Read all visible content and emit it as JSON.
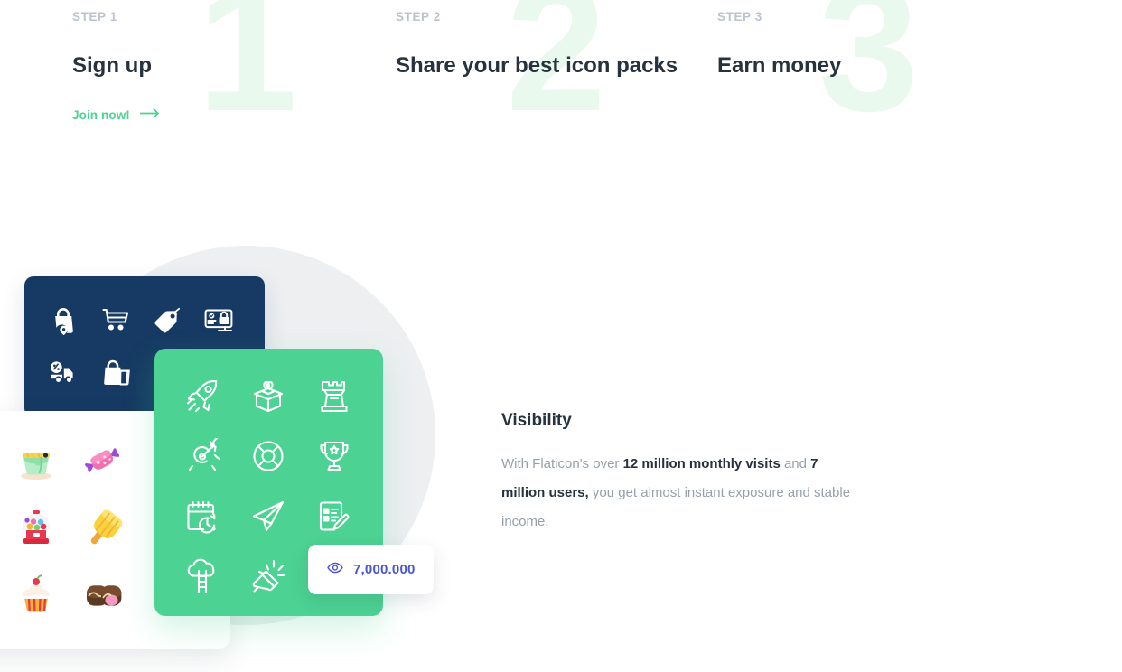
{
  "steps": [
    {
      "label": "STEP 1",
      "watermark": "1",
      "title": "Sign up",
      "cta": {
        "text": "Join now!",
        "icon": "arrow-right-icon"
      }
    },
    {
      "label": "STEP 2",
      "watermark": "2",
      "title": "Share your best icon packs"
    },
    {
      "label": "STEP 3",
      "watermark": "3",
      "title": "Earn money"
    }
  ],
  "illustration": {
    "navy_card": {
      "background": "#163a63",
      "icons": [
        "shopping-bag-location-icon",
        "shopping-cart-icon",
        "price-tag-icon",
        "online-shop-monitor-icon",
        "delivery-truck-discount-icon",
        "shopping-bags-icon"
      ]
    },
    "white_card": {
      "background": "#ffffff",
      "icons": [
        "pudding-icon",
        "wrapped-candy-icon",
        "gumball-machine-icon",
        "popsicle-icon",
        "cupcake-icon",
        "chocolate-bonbon-icon"
      ]
    },
    "green_card": {
      "background": "#4cd292",
      "icons": [
        "rocket-icon",
        "open-box-icon",
        "chess-rook-icon",
        "target-dart-icon",
        "lifebuoy-icon",
        "trophy-icon",
        "calendar-clock-icon",
        "paper-plane-icon",
        "checklist-edit-icon",
        "tree-ladder-icon",
        "megaphone-icon"
      ]
    },
    "views_badge": {
      "icon": "eye-icon",
      "value": "7,000.000",
      "value_color": "#4a55d6"
    }
  },
  "visibility": {
    "title": "Visibility",
    "text_parts": {
      "p1": "With Flaticon's over ",
      "b1": "12 million monthly visits",
      "p2": " and ",
      "b2": "7 million users,",
      "p3": " you get almost instant exposure and stable income."
    }
  },
  "colors": {
    "accent_green": "#4cd292",
    "navy": "#163a63",
    "heading": "#27323f",
    "muted": "#97a0ab",
    "watermark_green": "#e9f9ee",
    "badge_blue": "#4a55d6",
    "circle_gray": "#edeff1"
  }
}
